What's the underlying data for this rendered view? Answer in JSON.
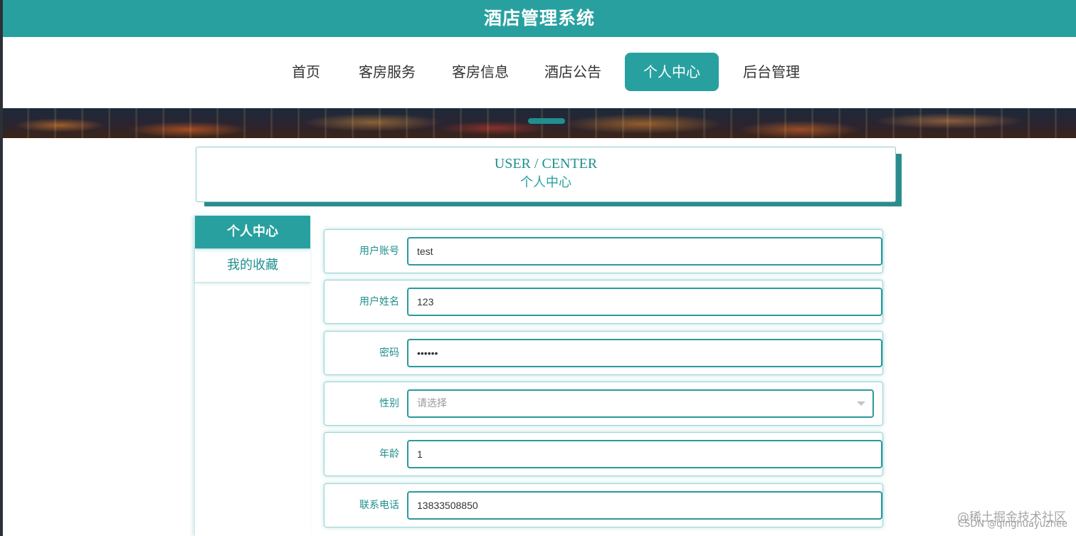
{
  "app": {
    "title": "酒店管理系统"
  },
  "nav": {
    "items": [
      {
        "label": "首页"
      },
      {
        "label": "客房服务"
      },
      {
        "label": "客房信息"
      },
      {
        "label": "酒店公告"
      },
      {
        "label": "个人中心"
      },
      {
        "label": "后台管理"
      }
    ],
    "active": "个人中心"
  },
  "section_header": {
    "en": "USER / CENTER",
    "cn": "个人中心"
  },
  "side_menu": {
    "items": [
      {
        "label": "个人中心"
      },
      {
        "label": "我的收藏"
      }
    ],
    "active": "个人中心"
  },
  "form": {
    "fields": [
      {
        "label": "用户账号",
        "value": "test",
        "type": "text"
      },
      {
        "label": "用户姓名",
        "value": "123",
        "type": "text"
      },
      {
        "label": "密码",
        "value": "••••••",
        "type": "password"
      },
      {
        "label": "性别",
        "value": "请选择",
        "type": "select"
      },
      {
        "label": "年龄",
        "value": "1",
        "type": "text"
      },
      {
        "label": "联系电话",
        "value": "13833508850",
        "type": "text"
      }
    ]
  },
  "watermark": {
    "text": "@稀土掘金技术社区",
    "csdn": "CSDN @qinghuayuzhee"
  },
  "colors": {
    "primary": "#29a0a0",
    "text_teal": "#1f8f8f",
    "border": "#2a9a9a"
  }
}
